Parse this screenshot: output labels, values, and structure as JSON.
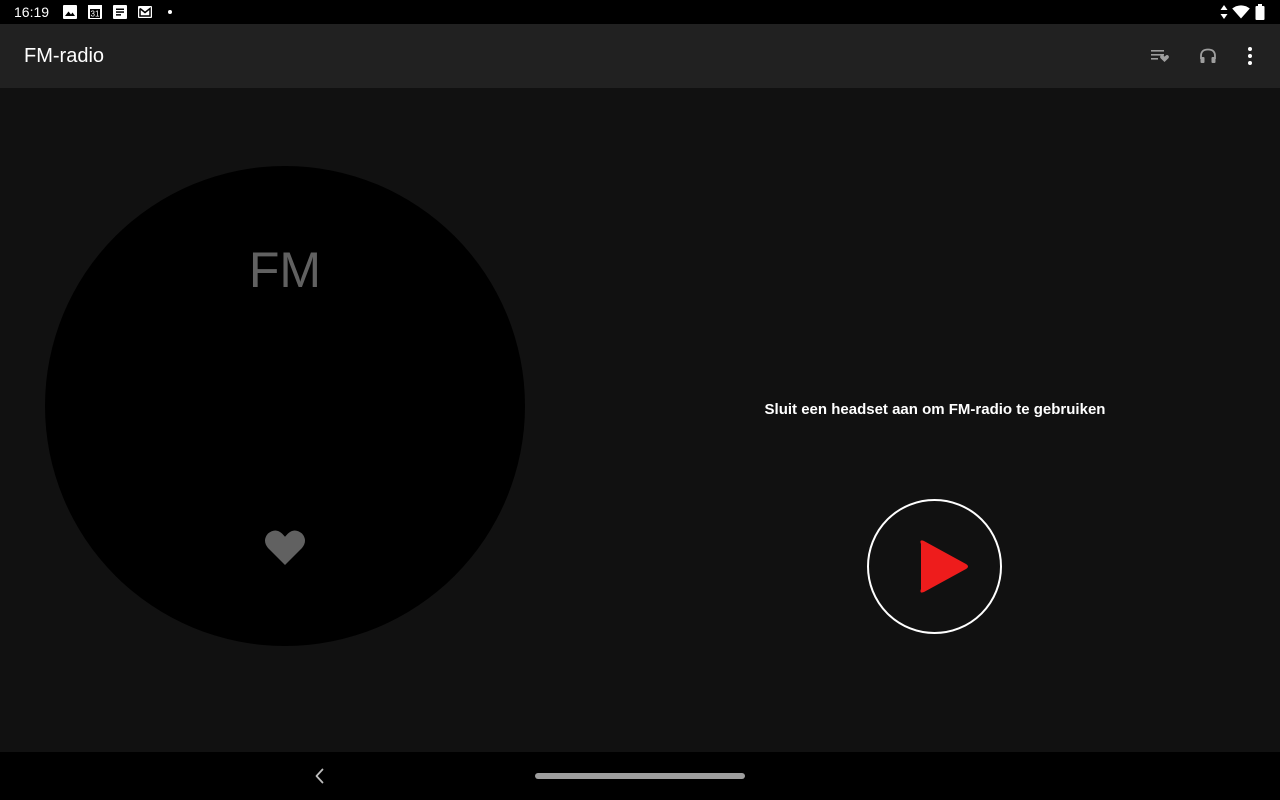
{
  "status_bar": {
    "time": "16:19",
    "calendar_day": "31",
    "left_icons": [
      "image-icon",
      "calendar-icon",
      "notes-icon",
      "gmail-icon",
      "more-notifications-dot"
    ],
    "right_icons": [
      "data-arrows-icon",
      "wifi-icon",
      "battery-icon"
    ]
  },
  "app_bar": {
    "title": "FM-radio",
    "actions": [
      "favorites-list-icon",
      "headset-icon",
      "more-vert-icon"
    ]
  },
  "dial": {
    "band": "FM",
    "favorite_icon": "heart-icon"
  },
  "message": "Sluit een headset aan om FM-radio te gebruiken",
  "play_button": {
    "icon": "play-icon",
    "accent_color": "#EE1C1C"
  },
  "nav_bar": {
    "icons": [
      "back-icon",
      "home-pill"
    ]
  },
  "colors": {
    "background": "#111111",
    "app_bar": "#212121",
    "dial": "#000000",
    "muted": "#616161",
    "accent": "#EE1C1C"
  }
}
